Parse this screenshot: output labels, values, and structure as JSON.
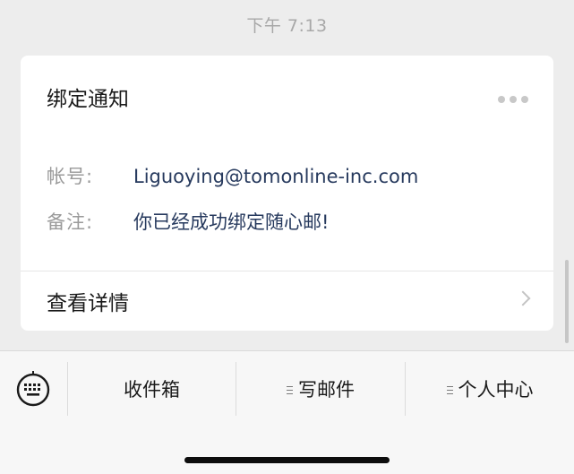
{
  "chat": {
    "timestamp": "下午 7:13"
  },
  "card": {
    "title": "绑定通知",
    "fields": [
      {
        "label": "帐号:",
        "value": "Liguoying@tomonline-inc.com"
      },
      {
        "label": "备注:",
        "value": "你已经成功绑定随心邮!"
      }
    ],
    "details_label": "查看详情"
  },
  "menu": {
    "keyboard_icon": "keyboard-icon",
    "items": [
      {
        "label": "收件箱",
        "has_submenu": false
      },
      {
        "label": "写邮件",
        "has_submenu": true
      },
      {
        "label": "个人中心",
        "has_submenu": true
      }
    ]
  },
  "colors": {
    "background": "#ededed",
    "card": "#ffffff",
    "value_text": "#273a5e",
    "label_text": "#9a9a9a"
  }
}
